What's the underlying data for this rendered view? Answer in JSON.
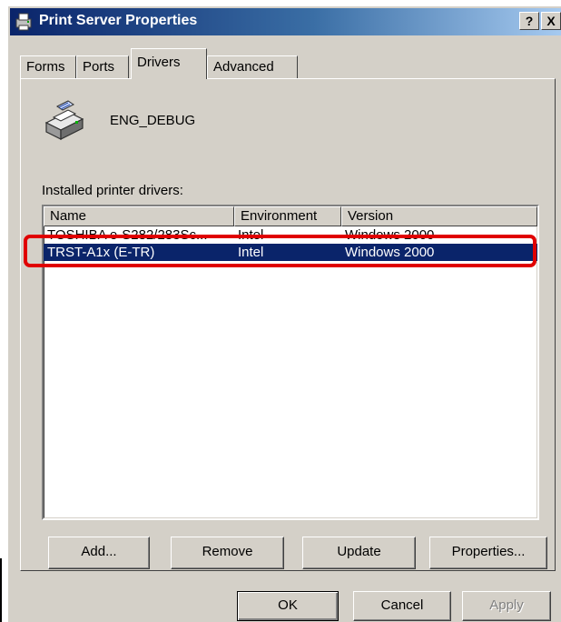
{
  "window": {
    "title": "Print Server Properties",
    "help_label": "?",
    "close_label": "X"
  },
  "tabs": [
    {
      "label": "Forms",
      "active": false
    },
    {
      "label": "Ports",
      "active": false
    },
    {
      "label": "Drivers",
      "active": true
    },
    {
      "label": "Advanced",
      "active": false
    }
  ],
  "server": {
    "name": "ENG_DEBUG",
    "icon": "printer-server-icon"
  },
  "drivers_list": {
    "label": "Installed printer drivers:",
    "columns": [
      "Name",
      "Environment",
      "Version"
    ],
    "rows": [
      {
        "name": "TOSHIBA e-S282/283Sc...",
        "environment": "Intel",
        "version": "Windows 2000",
        "struck": true
      },
      {
        "name": "TRST-A1x (E-TR)",
        "environment": "Intel",
        "version": "Windows 2000",
        "selected": true
      }
    ]
  },
  "actions": {
    "add": "Add...",
    "remove": "Remove",
    "update": "Update",
    "properties": "Properties..."
  },
  "dialog": {
    "ok": "OK",
    "cancel": "Cancel",
    "apply": "Apply"
  },
  "colors": {
    "selection": "#0a246a",
    "highlight_annotation": "#e00000",
    "dialog_face": "#d4d0c8"
  }
}
